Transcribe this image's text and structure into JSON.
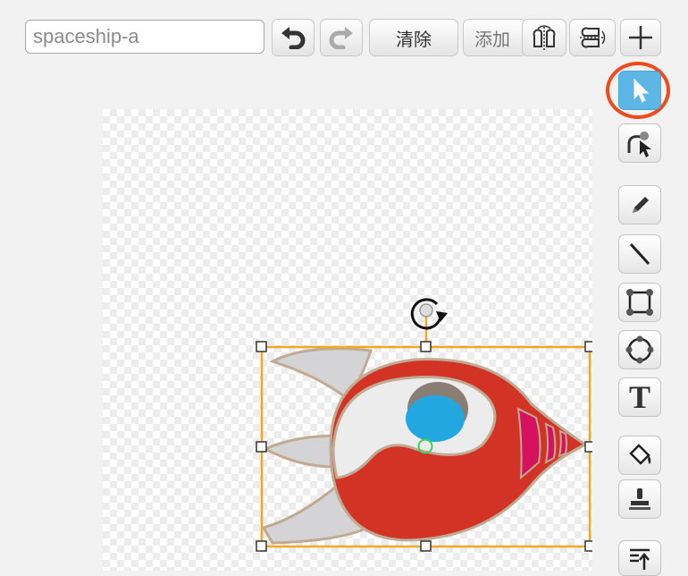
{
  "costume_name": {
    "value": "spaceship-a",
    "placeholder": ""
  },
  "toolbar": {
    "undo_icon": "undo-icon",
    "redo_icon": "redo-icon",
    "clear_label": "清除",
    "add_label": "添加",
    "flip_horizontal_icon": "flip-horizontal-icon",
    "flip_vertical_icon": "flip-vertical-icon",
    "set_center_icon": "crosshair-icon"
  },
  "tools": [
    {
      "name": "select",
      "icon": "arrow-select-icon",
      "active": true
    },
    {
      "name": "reshape",
      "icon": "reshape-icon",
      "active": false
    },
    {
      "name": "pencil",
      "icon": "pencil-icon",
      "active": false
    },
    {
      "name": "line",
      "icon": "line-icon",
      "active": false
    },
    {
      "name": "rectangle",
      "icon": "rectangle-icon",
      "active": false
    },
    {
      "name": "ellipse",
      "icon": "ellipse-icon",
      "active": false
    },
    {
      "name": "text",
      "icon": "text-icon",
      "active": false
    },
    {
      "name": "fill",
      "icon": "paint-bucket-icon",
      "active": false
    },
    {
      "name": "stamp",
      "icon": "stamp-icon",
      "active": false
    },
    {
      "name": "front",
      "icon": "bring-front-icon",
      "active": false
    }
  ],
  "text_tool_glyph": "T",
  "colors": {
    "accent_active": "#5cb7e6",
    "highlight_ring": "#f04a1a",
    "selection_box": "#f5a623",
    "ship_red": "#d33324",
    "ship_white": "#ececec",
    "ship_blue": "#22a7e0",
    "ship_gray": "#d4d4d6",
    "ship_magenta": "#d6115f"
  }
}
